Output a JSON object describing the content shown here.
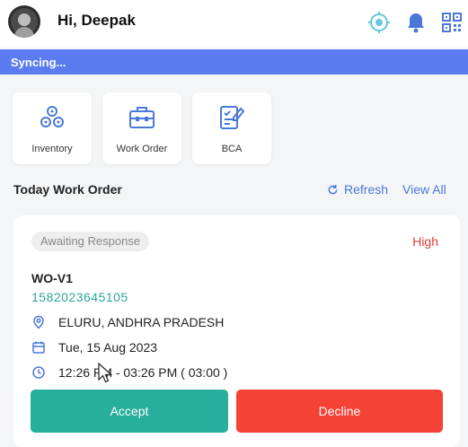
{
  "header": {
    "greeting": "Hi, Deepak",
    "icons": [
      "location-target-icon",
      "bell-icon",
      "qr-code-icon"
    ],
    "accent_color": "#4a78d8"
  },
  "sync": {
    "status_text": "Syncing...",
    "color": "#5b7cf0"
  },
  "quick_actions": [
    {
      "label": "Inventory",
      "icon": "inventory-icon"
    },
    {
      "label": "Work Order",
      "icon": "toolbox-icon"
    },
    {
      "label": "BCA",
      "icon": "clipboard-edit-icon"
    }
  ],
  "today": {
    "title": "Today Work Order",
    "refresh_label": "Refresh",
    "view_all_label": "View All"
  },
  "work_order": {
    "status": "Awaiting Response",
    "priority": "High",
    "code": "WO-V1",
    "number": "1582023645105",
    "location": "ELURU, ANDHRA PRADESH",
    "date": "Tue, 15 Aug 2023",
    "time": "12:26 PM - 03:26 PM ( 03:00 )",
    "accept_label": "Accept",
    "decline_label": "Decline",
    "accept_color": "#27ae9c",
    "decline_color": "#f44336"
  }
}
